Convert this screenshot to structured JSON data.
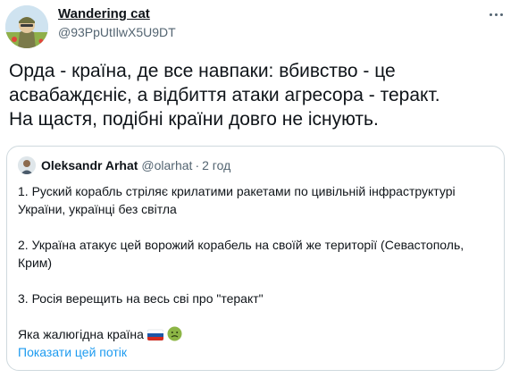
{
  "author": {
    "display_name": "Wandering cat",
    "handle": "@93PpUtIlwX5U9DT"
  },
  "tweet": {
    "text": "Орда - країна, де все навпаки: вбивство - це\nасвабаждєніє, а відбиття атаки агресора - теракт.\nНа щастя, подібні країни довго не існують."
  },
  "quoted": {
    "name": "Oleksandr Arhat",
    "handle": "@olarhat",
    "separator": "·",
    "time": "2 год",
    "paragraphs": [
      "1. Руский корабль стріляє крилатими ракетами по цивільній інфраструктурі України, українці без світла",
      "2. Україна атакує цей ворожий корабель на своїй же території (Севастополь, Крим)",
      "3. Росія верещить на весь сві про \"теракт\"",
      "Яка жалюгідна країна"
    ],
    "show_thread": "Показати цей потік"
  },
  "icons": {
    "more": "more-horizontal-icon",
    "flag": "russian-flag-emoji",
    "face": "nauseated-face-emoji"
  },
  "colors": {
    "text": "#0f1419",
    "secondary": "#536471",
    "link": "#1d9bf0",
    "border": "#cfd9de",
    "flag_white": "#ffffff",
    "flag_blue": "#1c57a7",
    "flag_red": "#d52b1e",
    "face_green": "#8cb545"
  }
}
